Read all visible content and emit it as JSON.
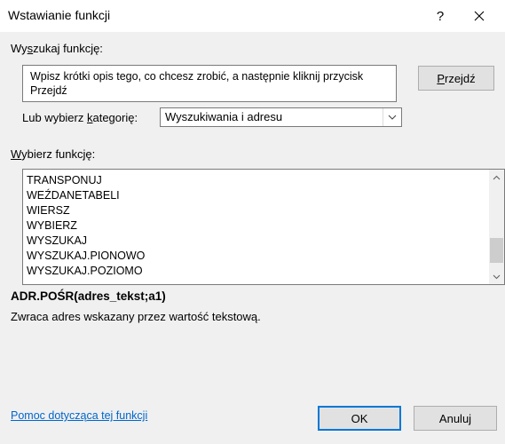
{
  "window": {
    "title": "Wstawianie funkcji",
    "help_label": "?",
    "close_icon": "close-icon"
  },
  "search": {
    "label_prefix": "Wy",
    "label_accel": "s",
    "label_suffix": "zukaj funkcję:",
    "value": "Wpisz krótki opis tego, co chcesz zrobić, a następnie kliknij przycisk Przejdź",
    "go_prefix": "",
    "go_accel": "P",
    "go_suffix": "rzejdź"
  },
  "category": {
    "label_prefix": "Lub wybierz ",
    "label_accel": "k",
    "label_suffix": "ategorię:",
    "selected": "Wyszukiwania i adresu"
  },
  "function_list": {
    "label_prefix": "",
    "label_accel": "W",
    "label_suffix": "ybierz funkcję:",
    "items": [
      "TRANSPONUJ",
      "WEŹDANETABELI",
      "WIERSZ",
      "WYBIERZ",
      "WYSZUKAJ",
      "WYSZUKAJ.PIONOWO",
      "WYSZUKAJ.POZIOMO"
    ]
  },
  "details": {
    "signature": "ADR.POŚR(adres_tekst;a1)",
    "description": "Zwraca adres wskazany przez wartość tekstową."
  },
  "footer": {
    "help_link": "Pomoc dotycząca tej funkcji",
    "ok_label": "OK",
    "cancel_label": "Anuluj"
  },
  "colors": {
    "accent": "#0078d7",
    "link": "#0066cc"
  }
}
